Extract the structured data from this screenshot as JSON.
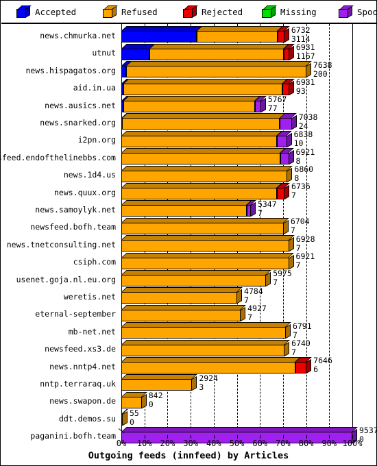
{
  "legend": {
    "items": [
      {
        "label": "Accepted",
        "color": "#0000ff",
        "icon": "cube-icon"
      },
      {
        "label": "Refused",
        "color": "#ffa500",
        "icon": "cube-icon"
      },
      {
        "label": "Rejected",
        "color": "#ee0000",
        "icon": "cube-icon"
      },
      {
        "label": "Missing",
        "color": "#00e000",
        "icon": "cube-icon"
      },
      {
        "label": "Spooled",
        "color": "#a020f0",
        "icon": "cube-icon"
      }
    ]
  },
  "chart_data": {
    "type": "bar",
    "orientation": "horizontal",
    "stacked": true,
    "title": "Outgoing feeds (innfeed) by Articles",
    "xlabel": "Outgoing feeds (innfeed) by Articles",
    "ylabel": "",
    "xlim": [
      0,
      100
    ],
    "x_unit": "percent",
    "grid": true,
    "legend_position": "top",
    "xticks": [
      "0%",
      "10%",
      "20%",
      "30%",
      "40%",
      "50%",
      "60%",
      "70%",
      "80%",
      "90%",
      "100%"
    ],
    "xtickvalues": [
      0,
      10,
      20,
      30,
      40,
      50,
      60,
      70,
      80,
      90,
      100
    ],
    "max_total": 9537,
    "series": [
      {
        "name": "Accepted",
        "color": "#0000ff"
      },
      {
        "name": "Refused",
        "color": "#ffa500"
      },
      {
        "name": "Rejected",
        "color": "#ee0000"
      },
      {
        "name": "Missing",
        "color": "#00e000"
      },
      {
        "name": "Spooled",
        "color": "#a020f0"
      }
    ],
    "categories": [
      "news.chmurka.net",
      "utnut",
      "news.hispagatos.org",
      "aid.in.ua",
      "news.ausics.net",
      "news.snarked.org",
      "i2pn.org",
      "newsfeed.endofthelinebbs.com",
      "news.1d4.us",
      "news.quux.org",
      "news.samoylyk.net",
      "newsfeed.bofh.team",
      "news.tnetconsulting.net",
      "csiph.com",
      "usenet.goja.nl.eu.org",
      "weretis.net",
      "eternal-september",
      "mb-net.net",
      "newsfeed.xs3.de",
      "news.nntp4.net",
      "nntp.terraraq.uk",
      "news.swapon.de",
      "ddt.demos.su",
      "paganini.bofh.team"
    ],
    "rows": [
      {
        "label": "news.chmurka.net",
        "top": 6732,
        "bottom": 3114,
        "accepted": 3114,
        "refused": 3330,
        "rejected": 288,
        "missing": 0,
        "spooled": 0
      },
      {
        "label": "utnut",
        "top": 6931,
        "bottom": 1167,
        "accepted": 1167,
        "refused": 5550,
        "rejected": 214,
        "missing": 0,
        "spooled": 0
      },
      {
        "label": "news.hispagatos.org",
        "top": 7638,
        "bottom": 200,
        "accepted": 200,
        "refused": 7438,
        "rejected": 0,
        "missing": 0,
        "spooled": 0
      },
      {
        "label": "aid.in.ua",
        "top": 6931,
        "bottom": 93,
        "accepted": 93,
        "refused": 6553,
        "rejected": 285,
        "missing": 0,
        "spooled": 0
      },
      {
        "label": "news.ausics.net",
        "top": 5767,
        "bottom": 77,
        "accepted": 77,
        "refused": 5440,
        "rejected": 0,
        "missing": 0,
        "spooled": 250
      },
      {
        "label": "news.snarked.org",
        "top": 7038,
        "bottom": 24,
        "accepted": 24,
        "refused": 6524,
        "rejected": 0,
        "missing": 0,
        "spooled": 490
      },
      {
        "label": "i2pn.org",
        "top": 6838,
        "bottom": 10,
        "accepted": 10,
        "refused": 6428,
        "rejected": 0,
        "missing": 0,
        "spooled": 400
      },
      {
        "label": "newsfeed.endofthelinebbs.com",
        "top": 6921,
        "bottom": 8,
        "accepted": 8,
        "refused": 6563,
        "rejected": 0,
        "missing": 0,
        "spooled": 350
      },
      {
        "label": "news.1d4.us",
        "top": 6860,
        "bottom": 8,
        "accepted": 8,
        "refused": 6852,
        "rejected": 0,
        "missing": 0,
        "spooled": 0
      },
      {
        "label": "news.quux.org",
        "top": 6736,
        "bottom": 7,
        "accepted": 7,
        "refused": 6429,
        "rejected": 300,
        "missing": 0,
        "spooled": 0
      },
      {
        "label": "news.samoylyk.net",
        "top": 5347,
        "bottom": 7,
        "accepted": 7,
        "refused": 5170,
        "rejected": 0,
        "missing": 0,
        "spooled": 170
      },
      {
        "label": "newsfeed.bofh.team",
        "top": 6704,
        "bottom": 7,
        "accepted": 7,
        "refused": 6697,
        "rejected": 0,
        "missing": 0,
        "spooled": 0
      },
      {
        "label": "news.tnetconsulting.net",
        "top": 6928,
        "bottom": 7,
        "accepted": 7,
        "refused": 6921,
        "rejected": 0,
        "missing": 0,
        "spooled": 0
      },
      {
        "label": "csiph.com",
        "top": 6921,
        "bottom": 7,
        "accepted": 7,
        "refused": 6914,
        "rejected": 0,
        "missing": 0,
        "spooled": 0
      },
      {
        "label": "usenet.goja.nl.eu.org",
        "top": 5975,
        "bottom": 7,
        "accepted": 7,
        "refused": 5968,
        "rejected": 0,
        "missing": 0,
        "spooled": 0
      },
      {
        "label": "weretis.net",
        "top": 4784,
        "bottom": 7,
        "accepted": 7,
        "refused": 4777,
        "rejected": 0,
        "missing": 0,
        "spooled": 0
      },
      {
        "label": "eternal-september",
        "top": 4927,
        "bottom": 7,
        "accepted": 7,
        "refused": 4920,
        "rejected": 0,
        "missing": 0,
        "spooled": 0
      },
      {
        "label": "mb-net.net",
        "top": 6791,
        "bottom": 7,
        "accepted": 7,
        "refused": 6784,
        "rejected": 0,
        "missing": 0,
        "spooled": 0
      },
      {
        "label": "newsfeed.xs3.de",
        "top": 6740,
        "bottom": 7,
        "accepted": 7,
        "refused": 6733,
        "rejected": 0,
        "missing": 0,
        "spooled": 0
      },
      {
        "label": "news.nntp4.net",
        "top": 7646,
        "bottom": 6,
        "accepted": 6,
        "refused": 7190,
        "rejected": 450,
        "missing": 0,
        "spooled": 0
      },
      {
        "label": "nntp.terraraq.uk",
        "top": 2924,
        "bottom": 3,
        "accepted": 3,
        "refused": 2921,
        "rejected": 0,
        "missing": 0,
        "spooled": 0
      },
      {
        "label": "news.swapon.de",
        "top": 842,
        "bottom": 0,
        "accepted": 0,
        "refused": 842,
        "rejected": 0,
        "missing": 0,
        "spooled": 0
      },
      {
        "label": "ddt.demos.su",
        "top": 55,
        "bottom": 0,
        "accepted": 0,
        "refused": 55,
        "rejected": 0,
        "missing": 0,
        "spooled": 0
      },
      {
        "label": "paganini.bofh.team",
        "top": 9537,
        "bottom": 0,
        "accepted": 0,
        "refused": 0,
        "rejected": 0,
        "missing": 0,
        "spooled": 9537
      }
    ]
  }
}
